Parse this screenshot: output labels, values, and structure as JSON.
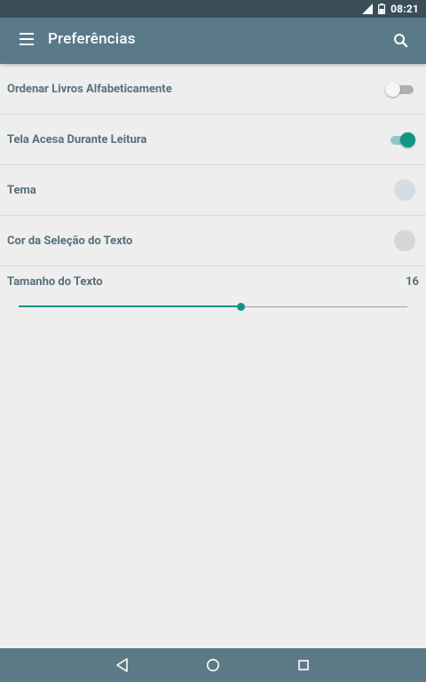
{
  "status_bar": {
    "time": "08:21"
  },
  "app_bar": {
    "title": "Preferências",
    "menu_icon": "menu-icon",
    "search_icon": "search-icon"
  },
  "preferences": [
    {
      "label": "Ordenar Livros Alfabeticamente",
      "control": "switch",
      "checked": false
    },
    {
      "label": "Tela Acesa Durante Leitura",
      "control": "switch",
      "checked": true
    },
    {
      "label": "Tema",
      "control": "color",
      "color": "#D3DDE3"
    },
    {
      "label": "Cor da Seleção do Texto",
      "control": "color",
      "color": "#D6D6D6"
    }
  ],
  "text_size": {
    "label": "Tamanho do Texto",
    "value": "16",
    "slider_fraction": 0.57
  },
  "colors": {
    "accent": "#109484",
    "app_bar": "#5B7A89",
    "status_bar": "#3A4E58",
    "label": "#56707C"
  },
  "nav_bar": {
    "icons": [
      "back-icon",
      "home-icon",
      "recents-icon"
    ]
  }
}
